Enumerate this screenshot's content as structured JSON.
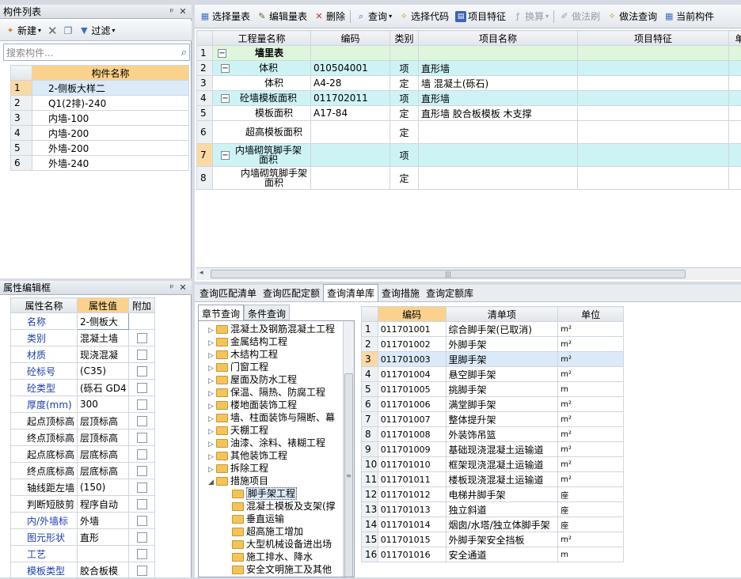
{
  "component_list": {
    "title": "构件列表",
    "pin_label": "ᵖ",
    "close_label": "✕",
    "toolbar": {
      "new_label": "新建",
      "filter_label": "过滤"
    },
    "search_placeholder": "搜索构件...",
    "column_header": "构件名称",
    "rows": [
      {
        "n": "1",
        "name": "2-侧板大样二"
      },
      {
        "n": "2",
        "name": "Q1(2排)-240"
      },
      {
        "n": "3",
        "name": "内墙-100"
      },
      {
        "n": "4",
        "name": "内墙-200"
      },
      {
        "n": "5",
        "name": "外墙-200"
      },
      {
        "n": "6",
        "name": "外墙-240"
      }
    ]
  },
  "property_editor": {
    "title": "属性编辑框",
    "headers": {
      "name": "属性名称",
      "value": "属性值",
      "extra": "附加"
    },
    "rows": [
      {
        "name": "名称",
        "value": "2-侧板大",
        "blue": true,
        "chk": false
      },
      {
        "name": "类别",
        "value": "混凝土墙",
        "blue": true,
        "chk": true
      },
      {
        "name": "材质",
        "value": "现浇混凝",
        "blue": true,
        "chk": true
      },
      {
        "name": "砼标号",
        "value": "(C35)",
        "blue": true,
        "chk": true
      },
      {
        "name": "砼类型",
        "value": "(砾石 GD4",
        "blue": true,
        "chk": true
      },
      {
        "name": "厚度(mm)",
        "value": "300",
        "blue": true,
        "chk": true
      },
      {
        "name": "起点顶标高",
        "value": "层顶标高",
        "blue": false,
        "chk": true
      },
      {
        "name": "终点顶标高",
        "value": "层顶标高",
        "blue": false,
        "chk": true
      },
      {
        "name": "起点底标高",
        "value": "层底标高",
        "blue": false,
        "chk": true
      },
      {
        "name": "终点底标高",
        "value": "层底标高",
        "blue": false,
        "chk": true
      },
      {
        "name": "轴线距左墙",
        "value": "(150)",
        "blue": false,
        "chk": true
      },
      {
        "name": "判断短肢剪",
        "value": "程序自动",
        "blue": false,
        "chk": true
      },
      {
        "name": "内/外墙标",
        "value": "外墙",
        "blue": true,
        "chk": true
      },
      {
        "name": "图元形状",
        "value": "直形",
        "blue": true,
        "chk": true
      },
      {
        "name": "工艺",
        "value": "",
        "blue": true,
        "chk": true
      },
      {
        "name": "模板类型",
        "value": "胶合板模",
        "blue": true,
        "chk": true
      }
    ]
  },
  "qty_toolbar": {
    "select_qty": "选择量表",
    "edit_qty": "编辑量表",
    "delete": "删除",
    "query": "查询",
    "select_code": "选择代码",
    "item_feature": "项目特征",
    "convert": "换算",
    "method_brush": "做法刷",
    "method_query": "做法查询",
    "current_comp": "当前构件"
  },
  "qty_table": {
    "headers": [
      "工程量名称",
      "编码",
      "类别",
      "项目名称",
      "项目特征",
      "单"
    ],
    "rows": [
      {
        "n": "1",
        "name": "墙里表",
        "code": "",
        "type": "",
        "item": "",
        "style": "green",
        "tree": "minus",
        "indent": 0
      },
      {
        "n": "2",
        "name": "体积",
        "code": "010504001",
        "type": "项",
        "item": "直形墙",
        "style": "cyan",
        "tree": "minus",
        "indent": 1
      },
      {
        "n": "3",
        "name": "体积",
        "code": "A4-28",
        "type": "定",
        "item": "墙 混凝土(砾石)",
        "style": "",
        "tree": "",
        "indent": 2
      },
      {
        "n": "4",
        "name": "砼墙模板面积",
        "code": "011702011",
        "type": "项",
        "item": "直形墙",
        "style": "cyan",
        "tree": "minus",
        "indent": 1
      },
      {
        "n": "5",
        "name": "模板面积",
        "code": "A17-84",
        "type": "定",
        "item": "直形墙 胶合板模板 木支撑",
        "style": "",
        "tree": "",
        "indent": 2
      },
      {
        "n": "6",
        "name": "超高模板面积",
        "code": "",
        "type": "定",
        "item": "",
        "style": "",
        "tree": "",
        "indent": 2
      },
      {
        "n": "7",
        "name": "内墙砌筑脚手架面积",
        "code": "",
        "type": "项",
        "item": "",
        "style": "cyan",
        "tree": "minus",
        "indent": 1
      },
      {
        "n": "8",
        "name": "内墙砌筑脚手架面积",
        "code": "",
        "type": "定",
        "item": "",
        "style": "",
        "tree": "",
        "indent": 2
      }
    ]
  },
  "bottom_tabs": [
    "查询匹配清单",
    "查询匹配定额",
    "查询清单库",
    "查询措施",
    "查询定额库"
  ],
  "sub_tabs": [
    "章节查询",
    "条件查询"
  ],
  "chapter_tree": [
    {
      "label": "混凝土及钢筋混凝土工程",
      "level": 0,
      "arrow": "▷"
    },
    {
      "label": "金属结构工程",
      "level": 0,
      "arrow": "▷"
    },
    {
      "label": "木结构工程",
      "level": 0,
      "arrow": "▷"
    },
    {
      "label": "门窗工程",
      "level": 0,
      "arrow": "▷"
    },
    {
      "label": "屋面及防水工程",
      "level": 0,
      "arrow": "▷"
    },
    {
      "label": "保温、隔热、防腐工程",
      "level": 0,
      "arrow": "▷"
    },
    {
      "label": "楼地面装饰工程",
      "level": 0,
      "arrow": "▷"
    },
    {
      "label": "墙、柱面装饰与隔断、幕",
      "level": 0,
      "arrow": "▷"
    },
    {
      "label": "天棚工程",
      "level": 0,
      "arrow": "▷"
    },
    {
      "label": "油漆、涂料、裱糊工程",
      "level": 0,
      "arrow": "▷"
    },
    {
      "label": "其他装饰工程",
      "level": 0,
      "arrow": "▷"
    },
    {
      "label": "拆除工程",
      "level": 0,
      "arrow": "▷"
    },
    {
      "label": "措施项目",
      "level": 0,
      "arrow": "◢"
    },
    {
      "label": "脚手架工程",
      "level": 1,
      "arrow": "",
      "selected": true
    },
    {
      "label": "混凝土模板及支架(撑",
      "level": 1,
      "arrow": ""
    },
    {
      "label": "垂直运输",
      "level": 1,
      "arrow": ""
    },
    {
      "label": "超高施工增加",
      "level": 1,
      "arrow": ""
    },
    {
      "label": "大型机械设备进出场",
      "level": 1,
      "arrow": ""
    },
    {
      "label": "施工排水、降水",
      "level": 1,
      "arrow": ""
    },
    {
      "label": "安全文明施工及其他",
      "level": 1,
      "arrow": ""
    }
  ],
  "bill_table": {
    "headers": [
      "编码",
      "清单项",
      "单位"
    ],
    "rows": [
      {
        "n": "1",
        "code": "011701001",
        "name": "综合脚手架(已取消)",
        "unit": "m²"
      },
      {
        "n": "2",
        "code": "011701002",
        "name": "外脚手架",
        "unit": "m²"
      },
      {
        "n": "3",
        "code": "011701003",
        "name": "里脚手架",
        "unit": "m²"
      },
      {
        "n": "4",
        "code": "011701004",
        "name": "悬空脚手架",
        "unit": "m²"
      },
      {
        "n": "5",
        "code": "011701005",
        "name": "挑脚手架",
        "unit": "m"
      },
      {
        "n": "6",
        "code": "011701006",
        "name": "满堂脚手架",
        "unit": "m²"
      },
      {
        "n": "7",
        "code": "011701007",
        "name": "整体提升架",
        "unit": "m²"
      },
      {
        "n": "8",
        "code": "011701008",
        "name": "外装饰吊篮",
        "unit": "m²"
      },
      {
        "n": "9",
        "code": "011701009",
        "name": "基础现浇混凝土运输道",
        "unit": "m²"
      },
      {
        "n": "10",
        "code": "011701010",
        "name": "框架现浇混凝土运输道",
        "unit": "m²"
      },
      {
        "n": "11",
        "code": "011701011",
        "name": "楼板现浇混凝土运输道",
        "unit": "m²"
      },
      {
        "n": "12",
        "code": "011701012",
        "name": "电梯井脚手架",
        "unit": "座"
      },
      {
        "n": "13",
        "code": "011701013",
        "name": "独立斜道",
        "unit": "座"
      },
      {
        "n": "14",
        "code": "011701014",
        "name": "烟囱/水塔/独立体脚手架",
        "unit": "座"
      },
      {
        "n": "15",
        "code": "011701015",
        "name": "外脚手架安全挡板",
        "unit": "m²"
      },
      {
        "n": "16",
        "code": "011701016",
        "name": "安全通道",
        "unit": "m"
      }
    ]
  }
}
